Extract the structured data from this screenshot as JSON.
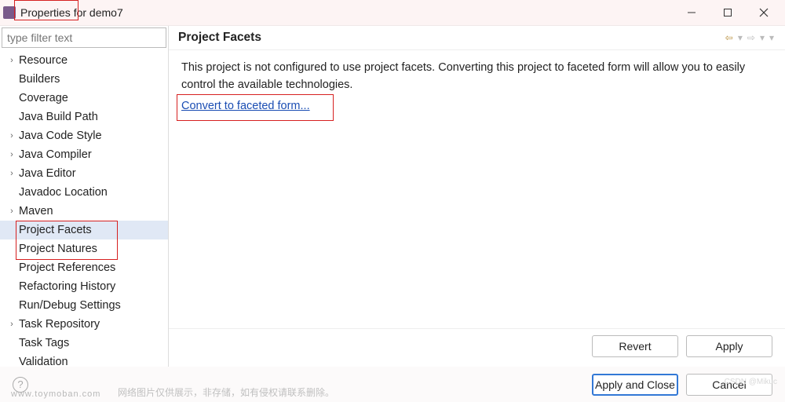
{
  "titlebar": {
    "text": "Properties for demo7"
  },
  "sidebar": {
    "filter_placeholder": "type filter text",
    "items": [
      {
        "label": "Resource",
        "expandable": true
      },
      {
        "label": "Builders",
        "expandable": false
      },
      {
        "label": "Coverage",
        "expandable": false
      },
      {
        "label": "Java Build Path",
        "expandable": false
      },
      {
        "label": "Java Code Style",
        "expandable": true
      },
      {
        "label": "Java Compiler",
        "expandable": true
      },
      {
        "label": "Java Editor",
        "expandable": true
      },
      {
        "label": "Javadoc Location",
        "expandable": false
      },
      {
        "label": "Maven",
        "expandable": true
      },
      {
        "label": "Project Facets",
        "expandable": false,
        "selected": true
      },
      {
        "label": "Project Natures",
        "expandable": false
      },
      {
        "label": "Project References",
        "expandable": false
      },
      {
        "label": "Refactoring History",
        "expandable": false
      },
      {
        "label": "Run/Debug Settings",
        "expandable": false
      },
      {
        "label": "Task Repository",
        "expandable": true
      },
      {
        "label": "Task Tags",
        "expandable": false
      },
      {
        "label": "Validation",
        "expandable": false
      }
    ]
  },
  "main": {
    "title": "Project Facets",
    "description": "This project is not configured to use project facets. Converting this project to faceted form will allow you to easily control the available technologies.",
    "link_text": "Convert to faceted form...",
    "revert": "Revert",
    "apply": "Apply"
  },
  "footer": {
    "apply_close": "Apply and Close",
    "cancel": "Cancel"
  },
  "watermark": {
    "url": "www.toymoban.com",
    "cn": "网络图片仅供展示，非存储，如有侵权请联系删除。",
    "csdn": "CSDN @Mikuc"
  }
}
